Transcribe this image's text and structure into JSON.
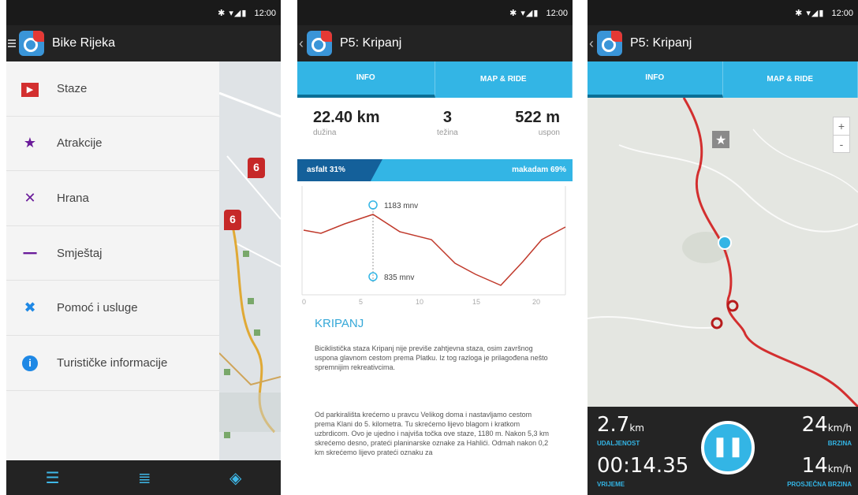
{
  "status": {
    "time": "12:00"
  },
  "screen1": {
    "title": "Bike Rijeka",
    "menu": [
      {
        "label": "Staze",
        "icon": "play-icon",
        "color": "#d32f2f"
      },
      {
        "label": "Atrakcije",
        "icon": "star-icon",
        "color": "#6a1b9a"
      },
      {
        "label": "Hrana",
        "icon": "fork-knife-icon",
        "color": "#6a1b9a"
      },
      {
        "label": "Smještaj",
        "icon": "bed-icon",
        "color": "#6a1b9a"
      },
      {
        "label": "Pomoć i usluge",
        "icon": "tools-icon",
        "color": "#1e88e5"
      },
      {
        "label": "Turističke informacije",
        "icon": "info-icon",
        "color": "#1e88e5"
      }
    ],
    "pins": [
      "6",
      "6"
    ]
  },
  "screen2": {
    "title": "P5: Kripanj",
    "tabs": [
      "INFO",
      "MAP & RIDE"
    ],
    "stats": [
      {
        "value": "22.40 km",
        "label": "dužina"
      },
      {
        "value": "3",
        "label": "težina"
      },
      {
        "value": "522 m",
        "label": "uspon"
      }
    ],
    "surface": {
      "asphalt": "asfalt 31%",
      "gravel": "makadam 69%"
    },
    "elevation": {
      "max": "1183 mnv",
      "min": "835 mnv",
      "xticks": [
        "0",
        "5",
        "10",
        "15",
        "20"
      ]
    },
    "section_title": "KRIPANJ",
    "paragraphs": [
      "Biciklistička staza Kripanj nije previše zahtjevna staza, osim završnog uspona glavnom cestom prema Platku. Iz tog razloga je prilagođena nešto spremnijim rekreativcima.",
      "Od parkirališta krećemo u pravcu Velikog doma i nastavljamo cestom prema Klani do 5. kilometra. Tu skrećemo lijevo blagom i kratkom uzbrdicom. Ovo je ujedno i najviša točka ove staze, 1180 m. Nakon 5,3 km skrećemo desno, prateći planinarske oznake za Hahlići. Odmah nakon 0,2 km skrećemo lijevo prateći oznaku za"
    ]
  },
  "screen3": {
    "title": "P5: Kripanj",
    "tabs": [
      "INFO",
      "MAP & RIDE"
    ],
    "zoom": [
      "+",
      "-"
    ],
    "ride": {
      "distance": "2.7",
      "distance_unit": "km",
      "distance_label": "UDALJENOST",
      "speed": "24",
      "speed_unit": "km/h",
      "speed_label": "BRZINA",
      "time": "00:14.35",
      "time_label": "VRIJEME",
      "avg_speed": "14",
      "avg_unit": "km/h",
      "avg_label": "PROSJEČNA BRZINA"
    }
  }
}
